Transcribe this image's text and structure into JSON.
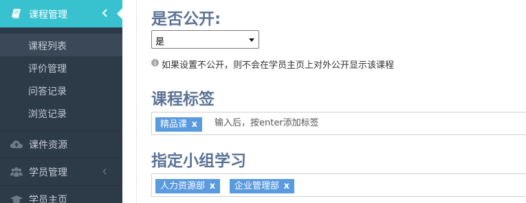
{
  "sidebar": {
    "active_menu": {
      "label": "课程管理",
      "icon": "book-icon"
    },
    "sub_items": [
      {
        "label": "课程列表",
        "selected": true
      },
      {
        "label": "评价管理",
        "selected": false
      },
      {
        "label": "问答记录",
        "selected": false
      },
      {
        "label": "浏览记录",
        "selected": false
      }
    ],
    "menus": [
      {
        "label": "课件资源",
        "icon": "cloud-upload-icon",
        "has_chevron": false
      },
      {
        "label": "学员管理",
        "icon": "users-icon",
        "has_chevron": true
      },
      {
        "label": "学员主页",
        "icon": "graduation-cap-icon",
        "has_chevron": false
      }
    ]
  },
  "form": {
    "public_section": {
      "title": "是否公开:",
      "select_value": "是",
      "hint": "如果设置不公开，则不会在学员主页上对外公开显示该课程"
    },
    "tags_section": {
      "title": "课程标签",
      "tags": [
        {
          "label": "精品课",
          "remove": "x"
        }
      ],
      "input_placeholder": "输入后，按enter添加标签"
    },
    "group_section": {
      "title": "指定小组学习",
      "tags": [
        {
          "label": "人力资源部",
          "remove": "x"
        },
        {
          "label": "企业管理部",
          "remove": "x"
        }
      ]
    }
  },
  "colors": {
    "sidebar_bg": "#2d3a48",
    "active_menu_bg": "#38c2d0",
    "section_title": "#5b7396",
    "tag_bg": "#5a9ade"
  }
}
